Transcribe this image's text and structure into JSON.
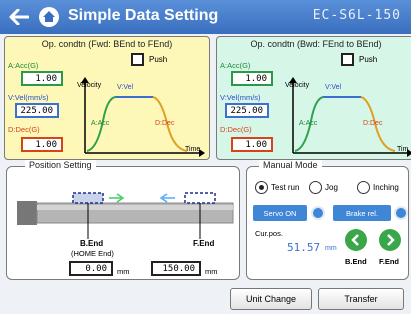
{
  "header": {
    "back_icon": "back-arrow-icon",
    "home_icon": "home-icon",
    "title": "Simple Data Setting",
    "model": "EC-S6L-150",
    "bg_color": "#4a7fcc"
  },
  "fwd": {
    "title": "Op. condtn (Fwd: BEnd to FEnd)",
    "push_label": "Push",
    "acc_label": "A:Acc(G)",
    "acc_value": "1.00",
    "vel_label": "V:Vel(mm/s)",
    "vel_value": "225.00",
    "dec_label": "D:Dec(G)",
    "dec_value": "1.00",
    "graph": {
      "velocity": "Velocity",
      "vvel": "V:Vel",
      "aacc": "A:Acc",
      "ddec": "D:Dec",
      "time": "Time"
    },
    "bg_color": "#fdf7b8"
  },
  "bwd": {
    "title": "Op. condtn (Bwd: FEnd to BEnd)",
    "push_label": "Push",
    "acc_label": "A:Acc(G)",
    "acc_value": "1.00",
    "vel_label": "V:Vel(mm/s)",
    "vel_value": "225.00",
    "dec_label": "D:Dec(G)",
    "dec_value": "1.00",
    "graph": {
      "velocity": "Velocity",
      "vvel": "V:Vel",
      "aacc": "A:Acc",
      "ddec": "D:Dec",
      "time": "Tim"
    },
    "bg_color": "#d6f6e8"
  },
  "position": {
    "title": "Position Setting",
    "bend_label": "B.End",
    "home_label": "(HOME End)",
    "fend_label": "F.End",
    "bend_value": "0.00",
    "fend_value": "150.00",
    "unit": "mm"
  },
  "manual": {
    "title": "Manual Mode",
    "options": [
      "Test run",
      "Jog",
      "Inching"
    ],
    "selected": "Test run",
    "servo_label": "Servo ON",
    "brake_label": "Brake rel.",
    "curpos_label": "Cur.pos.",
    "curpos_value": "51.57",
    "curpos_unit": "mm",
    "bend_btn": "B.End",
    "fend_btn": "F.End",
    "left_icon": "arrow-left-icon",
    "right_icon": "arrow-right-icon"
  },
  "footer": {
    "unit_change": "Unit Change",
    "transfer": "Transfer"
  }
}
